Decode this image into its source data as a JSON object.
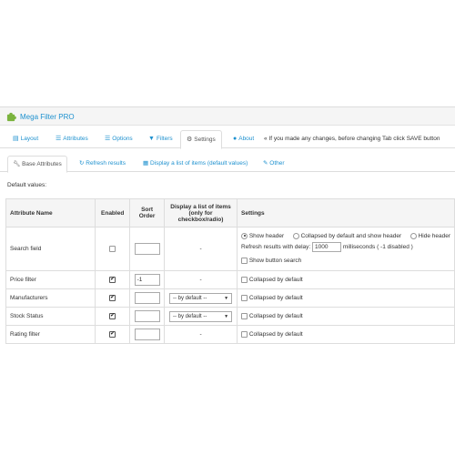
{
  "header": {
    "title": "Mega Filter PRO"
  },
  "tabs": [
    {
      "label": "Layout",
      "icon": "file-icon"
    },
    {
      "label": "Attributes",
      "icon": "list-icon"
    },
    {
      "label": "Options",
      "icon": "list-icon"
    },
    {
      "label": "Filters",
      "icon": "filter-icon"
    },
    {
      "label": "Settings",
      "icon": "gear-icon"
    },
    {
      "label": "About",
      "icon": "question-icon"
    }
  ],
  "tab_note": "« If you made any changes, before changing Tab click SAVE button",
  "subtabs": [
    {
      "label": "Base Attributes",
      "icon": "wrench-icon"
    },
    {
      "label": "Refresh results",
      "icon": "refresh-icon"
    },
    {
      "label": "Display a list of items (default values)",
      "icon": "calendar-icon"
    },
    {
      "label": "Other",
      "icon": "pencil-icon"
    }
  ],
  "defaults_label": "Default values:",
  "table": {
    "headers": [
      "Attribute Name",
      "Enabled",
      "Sort Order",
      "Display a list of items (only for checkbox/radio)",
      "Settings"
    ],
    "rows": [
      {
        "name": "Search field",
        "enabled": false,
        "sort": "",
        "display": "-"
      },
      {
        "name": "Price filter",
        "enabled": true,
        "sort": "-1",
        "display": "-",
        "setting": "Collapsed by default"
      },
      {
        "name": "Manufacturers",
        "enabled": true,
        "sort": "",
        "display": "-- by default --",
        "setting": "Collapsed by default"
      },
      {
        "name": "Stock Status",
        "enabled": true,
        "sort": "",
        "display": "-- by default --",
        "setting": "Collapsed by default"
      },
      {
        "name": "Rating filter",
        "enabled": true,
        "sort": "",
        "display": "-",
        "setting": "Collapsed by default"
      }
    ],
    "search_settings": {
      "radio_show_header": "Show header",
      "radio_collapsed": "Collapsed by default and show header",
      "radio_hide_header": "Hide header",
      "delay_label": "Refresh results with delay:",
      "delay_value": "1000",
      "delay_unit": "milliseconds ( -1 disabled )",
      "show_button": "Show button search"
    }
  },
  "colors": {
    "accent": "#1e91cf",
    "border": "#dddddd",
    "header_bg": "#f5f5f5"
  }
}
